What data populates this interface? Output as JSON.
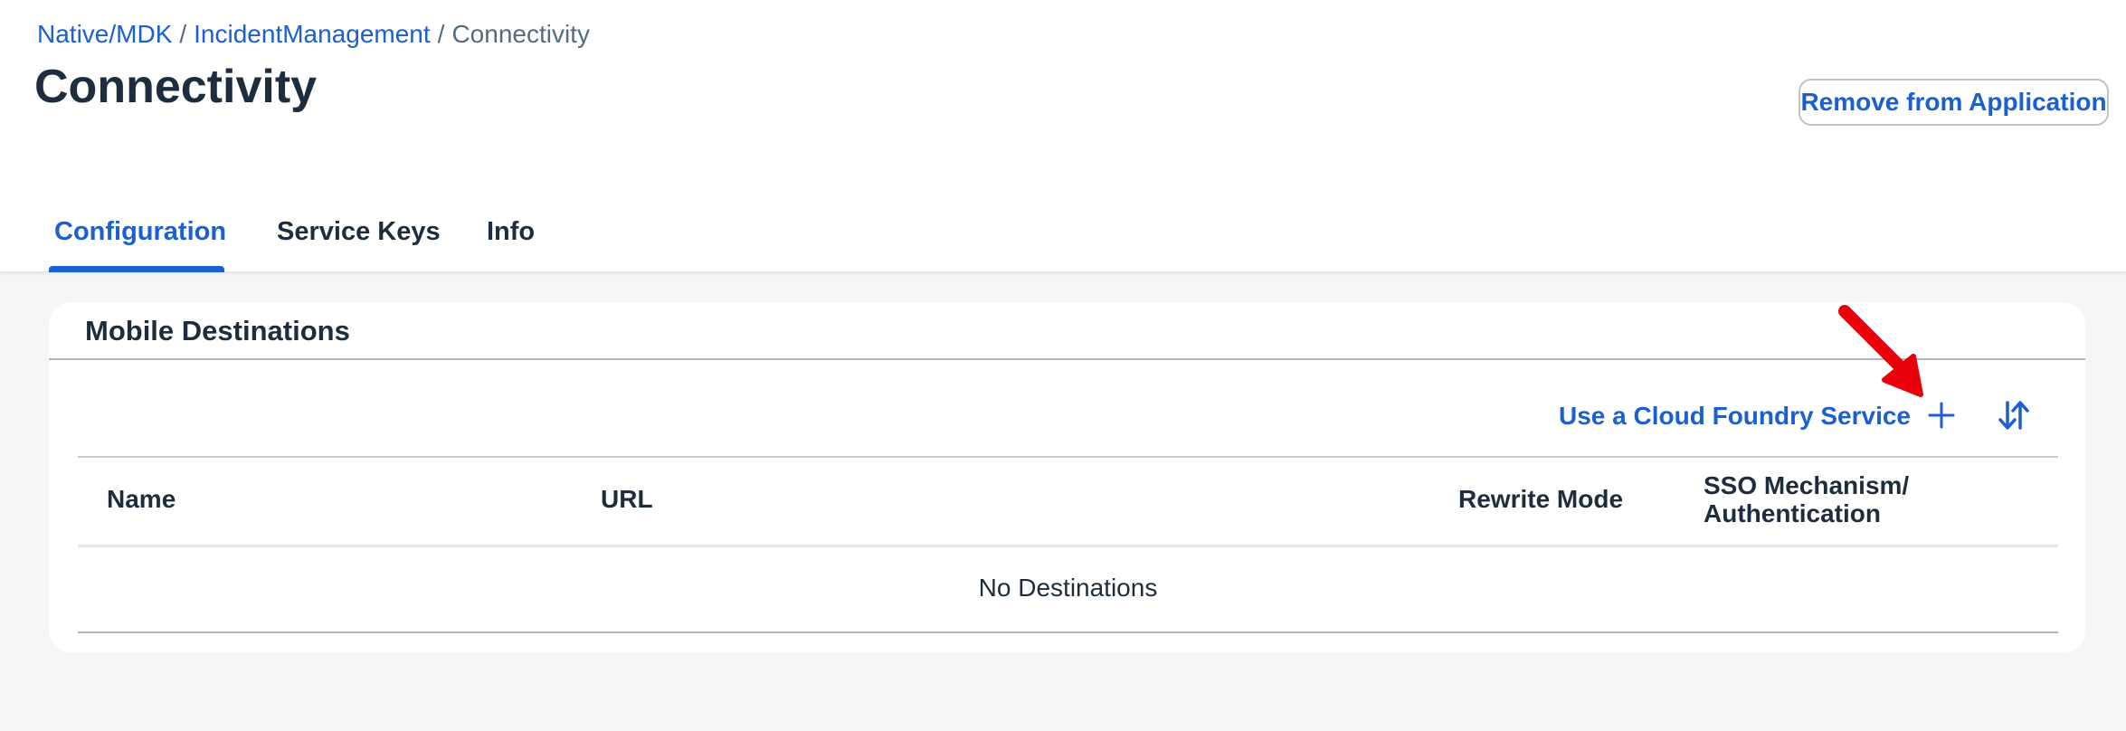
{
  "breadcrumb": {
    "items": [
      "Native/MDK",
      "IncidentManagement"
    ],
    "separator": "/",
    "current": "Connectivity"
  },
  "page": {
    "title": "Connectivity",
    "remove_button_label": "Remove from Application"
  },
  "tabs": [
    {
      "label": "Configuration",
      "active": true
    },
    {
      "label": "Service Keys",
      "active": false
    },
    {
      "label": "Info",
      "active": false
    }
  ],
  "card": {
    "title": "Mobile Destinations",
    "toolbar": {
      "cloud_foundry_link": "Use a Cloud Foundry Service",
      "add_icon": "plus-icon",
      "sort_icon": "sort-icon"
    },
    "table": {
      "columns": [
        "Name",
        "URL",
        "Rewrite Mode",
        "SSO Mechanism/",
        "Authentication"
      ],
      "empty_text": "No Destinations"
    }
  },
  "annotation": {
    "icon": "red-arrow-icon",
    "color": "#e8000b"
  },
  "colors": {
    "accent": "#1c5fd0",
    "text": "#1d2d3e",
    "background": "#f5f6f7"
  }
}
